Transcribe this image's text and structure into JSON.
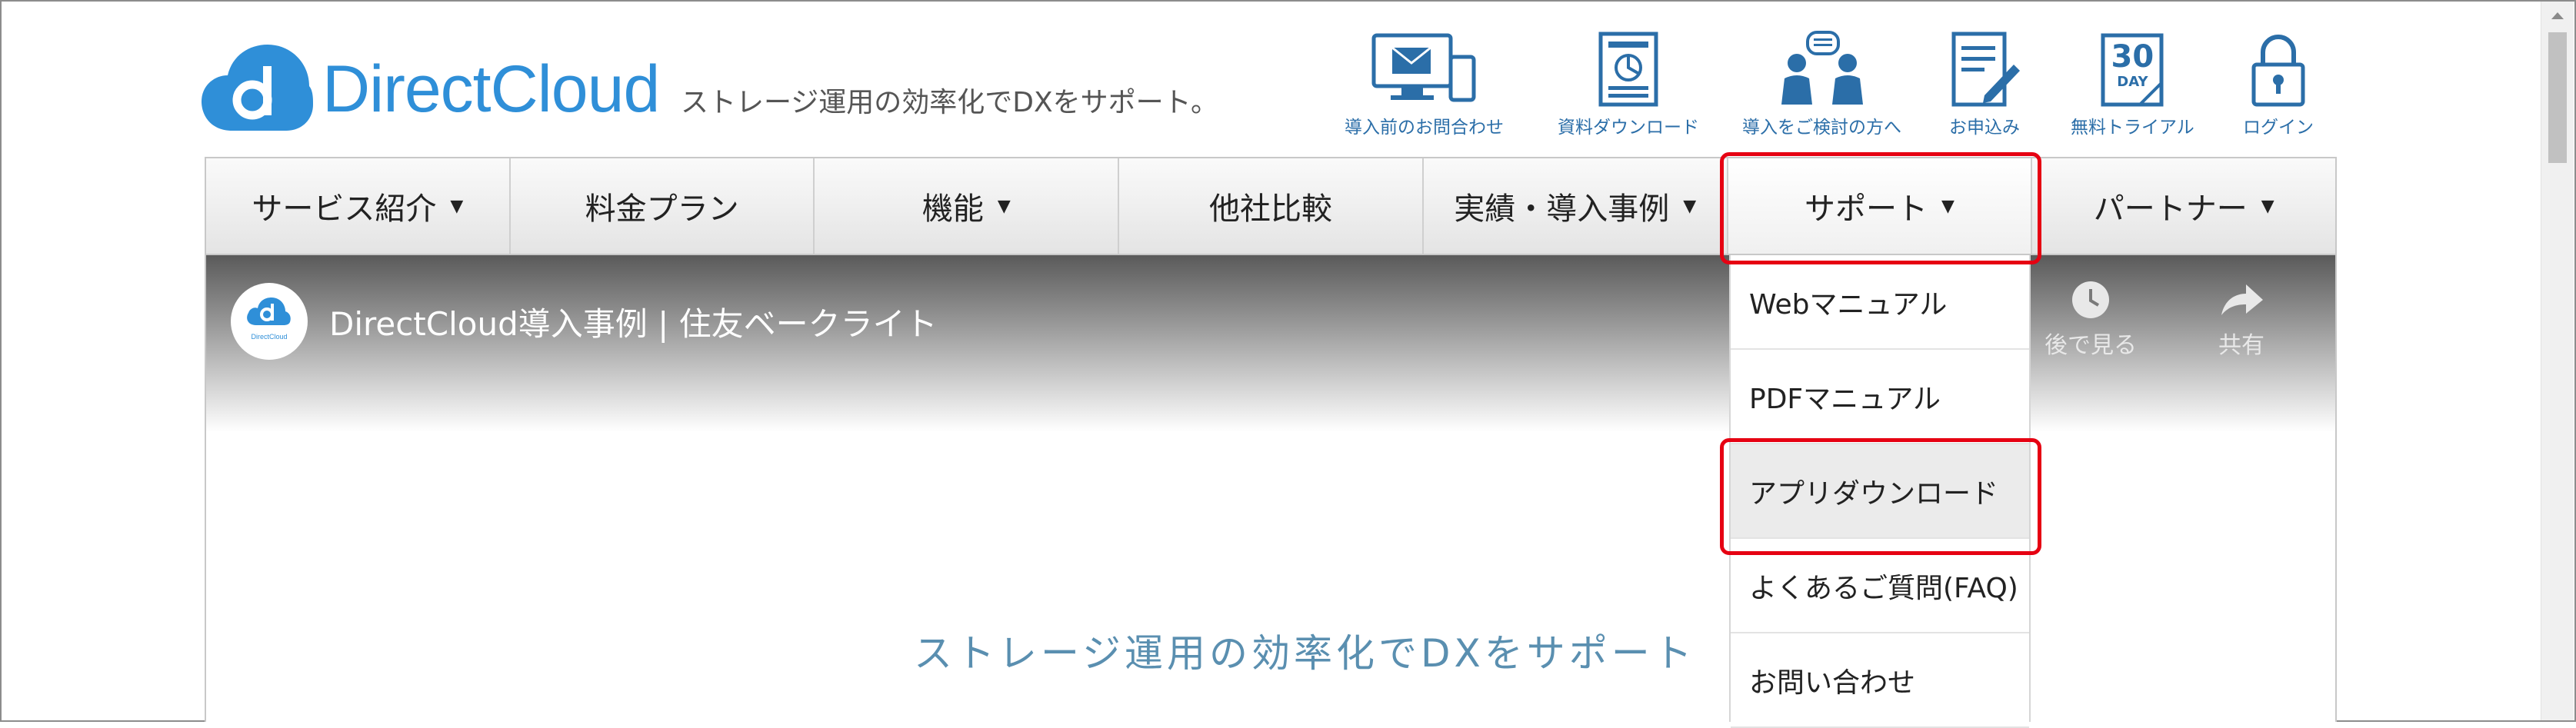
{
  "brand": {
    "name": "DirectCloud",
    "tagline": "ストレージ運用の効率化でDXをサポート。",
    "logo_color": "#2f8fd8"
  },
  "top_links": [
    {
      "label": "導入前のお問合わせ",
      "icon": "monitor-mail-icon"
    },
    {
      "label": "資料ダウンロード",
      "icon": "document-icon"
    },
    {
      "label": "導入をご検討の方へ",
      "icon": "people-chat-icon"
    },
    {
      "label": "お申込み",
      "icon": "form-pen-icon"
    },
    {
      "label": "無料トライアル",
      "icon": "calendar-30-icon",
      "icon_text_top": "30",
      "icon_text_bottom": "DAY"
    },
    {
      "label": "ログイン",
      "icon": "lock-icon"
    }
  ],
  "nav": [
    {
      "label": "サービス紹介",
      "caret": "▼"
    },
    {
      "label": "料金プラン"
    },
    {
      "label": "機能",
      "caret": "▼"
    },
    {
      "label": "他社比較"
    },
    {
      "label": "実績・導入事例",
      "caret": "▼"
    },
    {
      "label": "サポート",
      "caret": "▼"
    },
    {
      "label": "パートナー",
      "caret": "▼"
    }
  ],
  "dropdown": [
    {
      "label": "Webマニュアル"
    },
    {
      "label": "PDFマニュアル"
    },
    {
      "label": "アプリダウンロード"
    },
    {
      "label": "よくあるご質問(FAQ)"
    },
    {
      "label": "お問い合わせ"
    }
  ],
  "video": {
    "avatar_text": "DirectCloud",
    "title": "DirectCloud導入事例 | 住友ベークライト",
    "watch_later": "後で見る",
    "share": "共有",
    "caption": "ストレージ運用の効率化でDXをサポート"
  },
  "highlight_color": "#e60012"
}
